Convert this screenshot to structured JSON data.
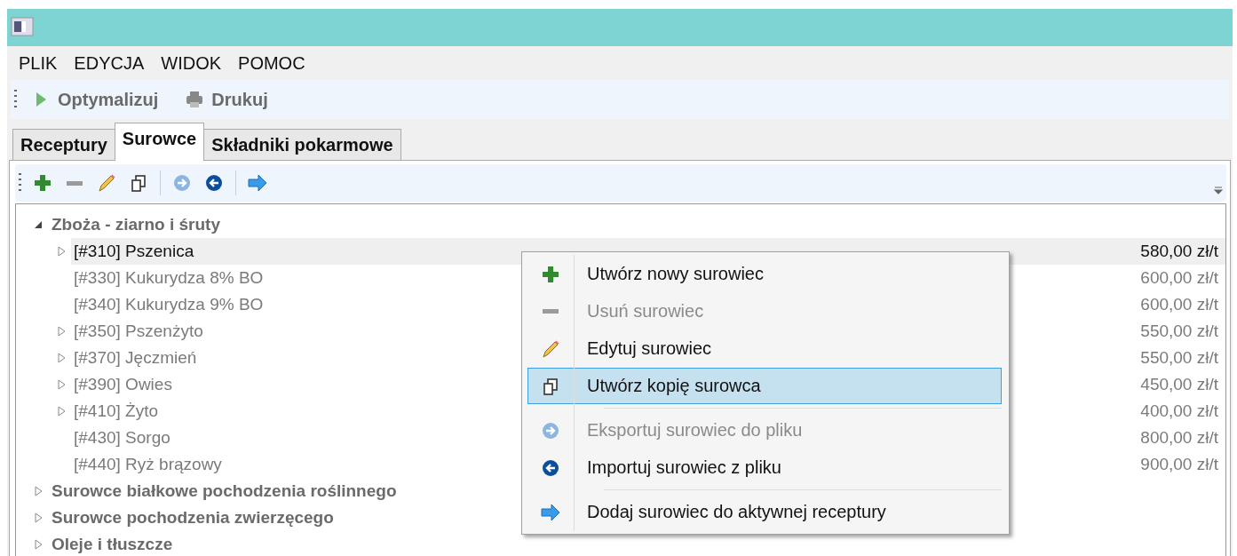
{
  "menu_bar": [
    "PLIK",
    "EDYCJA",
    "WIDOK",
    "POMOC"
  ],
  "toolbar": [
    {
      "kind": "run",
      "label": "Optymalizuj"
    },
    {
      "kind": "print",
      "label": "Drukuj"
    }
  ],
  "tabs": [
    {
      "label": "Receptury",
      "selected": false
    },
    {
      "label": "Surowce",
      "selected": true
    },
    {
      "label": "Składniki pokarmowe",
      "selected": false
    }
  ],
  "panel_toolbar": [
    {
      "kind": "add",
      "disabled": false
    },
    {
      "kind": "remove",
      "disabled": true
    },
    {
      "kind": "edit",
      "disabled": false
    },
    {
      "kind": "copy",
      "disabled": false
    },
    {
      "kind": "sep"
    },
    {
      "kind": "export",
      "disabled": true
    },
    {
      "kind": "import",
      "disabled": false
    },
    {
      "kind": "sep"
    },
    {
      "kind": "add-to-recipe",
      "disabled": false
    }
  ],
  "tree": [
    {
      "label": "Zboża - ziarno i śruty",
      "expanded": true,
      "children": [
        {
          "name": "[#310] Pszenica",
          "price": "580,00 zł/t",
          "expandable": true,
          "selected": true
        },
        {
          "name": "[#330] Kukurydza 8% BO",
          "price": "600,00 zł/t",
          "expandable": false,
          "selected": false
        },
        {
          "name": "[#340] Kukurydza 9% BO",
          "price": "600,00 zł/t",
          "expandable": false,
          "selected": false
        },
        {
          "name": "[#350] Pszenżyto",
          "price": "550,00 zł/t",
          "expandable": true,
          "selected": false
        },
        {
          "name": "[#370] Jęczmień",
          "price": "550,00 zł/t",
          "expandable": true,
          "selected": false
        },
        {
          "name": "[#390] Owies",
          "price": "450,00 zł/t",
          "expandable": true,
          "selected": false
        },
        {
          "name": "[#410] Żyto",
          "price": "400,00 zł/t",
          "expandable": true,
          "selected": false
        },
        {
          "name": "[#430] Sorgo",
          "price": "800,00 zł/t",
          "expandable": false,
          "selected": false
        },
        {
          "name": "[#440] Ryż brązowy",
          "price": "900,00 zł/t",
          "expandable": false,
          "selected": false
        }
      ]
    },
    {
      "label": "Surowce białkowe pochodzenia roślinnego",
      "expanded": false
    },
    {
      "label": "Surowce pochodzenia zwierzęcego",
      "expanded": false
    },
    {
      "label": "Oleje i tłuszcze",
      "expanded": false
    }
  ],
  "context_menu": [
    {
      "kind": "add",
      "label": "Utwórz nowy surowiec",
      "disabled": false,
      "selected": false
    },
    {
      "kind": "remove",
      "label": "Usuń surowiec",
      "disabled": true,
      "selected": false
    },
    {
      "kind": "edit",
      "label": "Edytuj surowiec",
      "disabled": false,
      "selected": false
    },
    {
      "kind": "copy",
      "label": "Utwórz kopię surowca",
      "disabled": false,
      "selected": true
    },
    {
      "kind": "sep"
    },
    {
      "kind": "export",
      "label": "Eksportuj surowiec do pliku",
      "disabled": true,
      "selected": false
    },
    {
      "kind": "import",
      "label": "Importuj surowiec z pliku",
      "disabled": false,
      "selected": false
    },
    {
      "kind": "sep"
    },
    {
      "kind": "add-to-recipe",
      "label": "Dodaj surowiec do aktywnej receptury",
      "disabled": false,
      "selected": false
    }
  ]
}
